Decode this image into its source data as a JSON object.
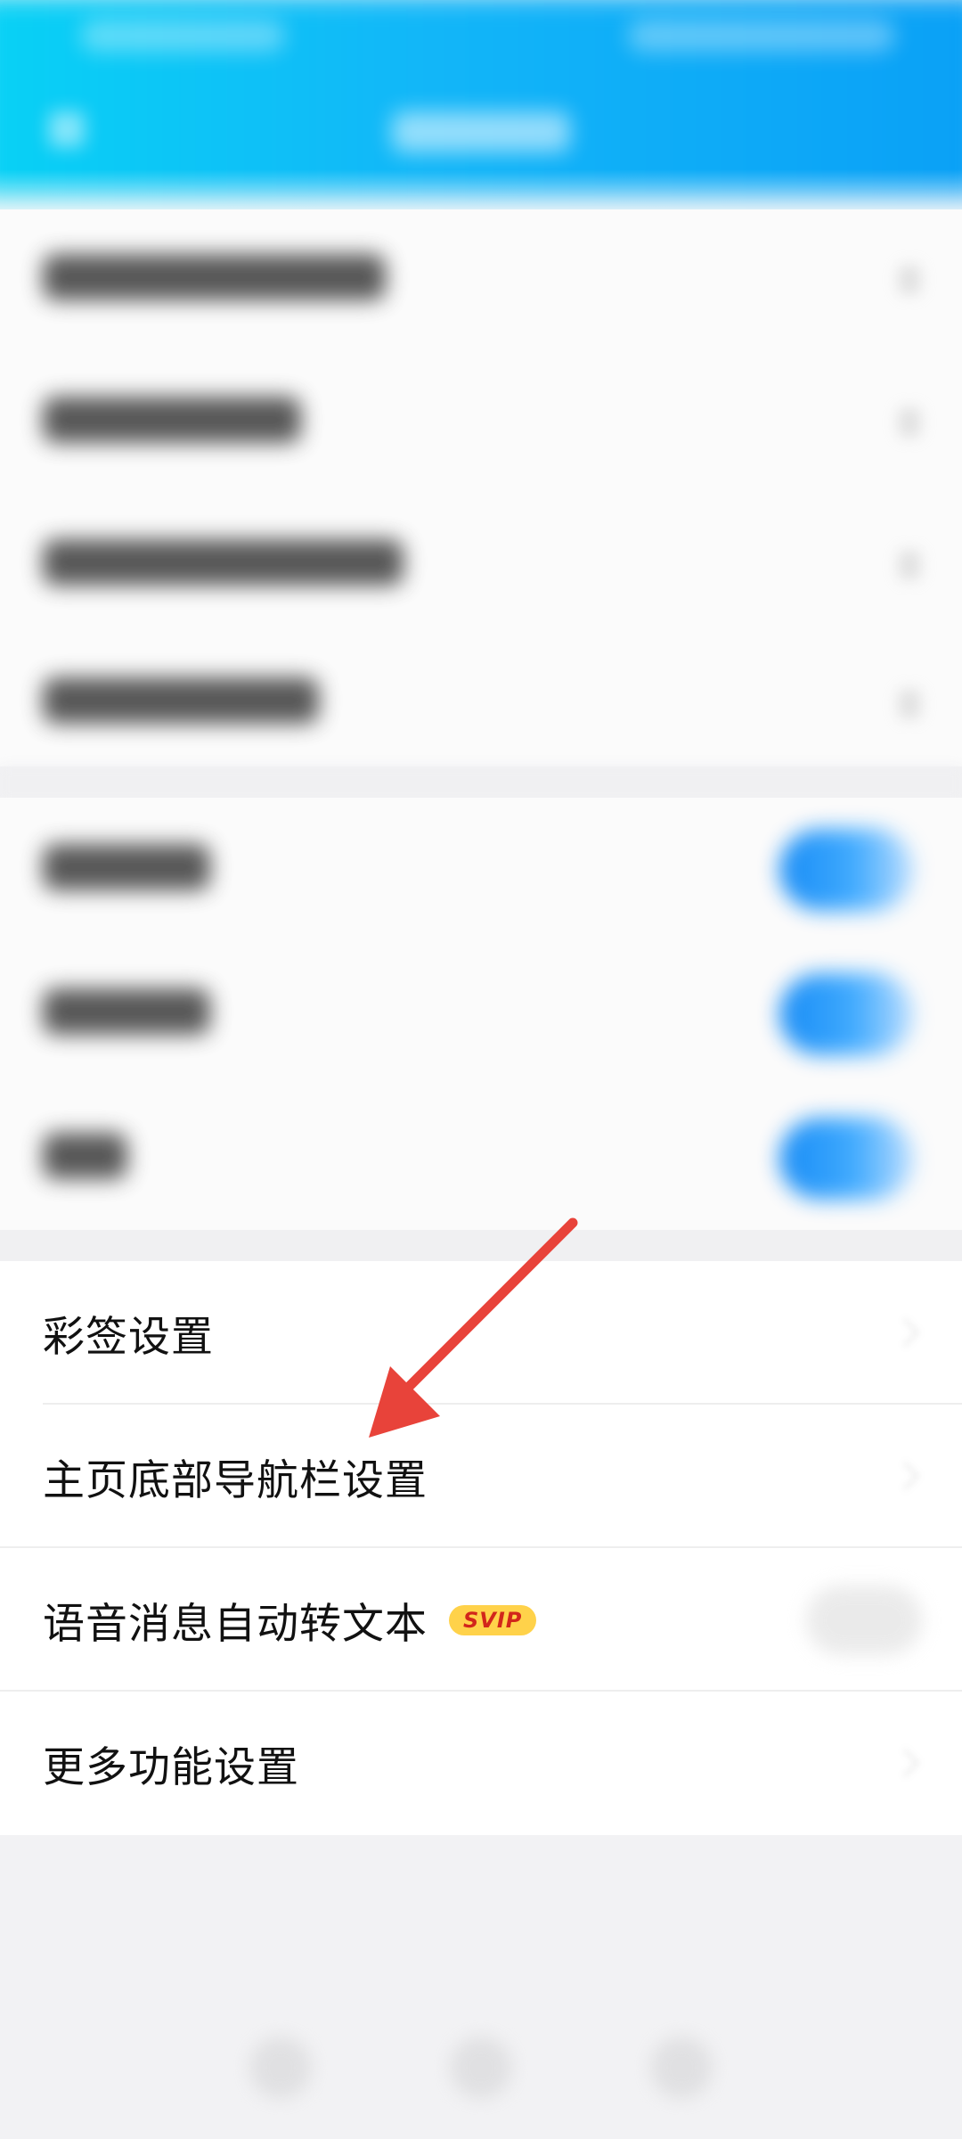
{
  "settings_list": {
    "items": [
      {
        "label": "彩签设置"
      },
      {
        "label": "主页底部导航栏设置"
      },
      {
        "label": "语音消息自动转文本",
        "badge": "SVIP"
      },
      {
        "label": "更多功能设置"
      }
    ]
  },
  "colors": {
    "header_gradient_start": "#08d2f5",
    "header_gradient_end": "#0aa0f6",
    "toggle_on": "#0b86f5",
    "arrow": "#e8433a",
    "badge_bg": "#ffd24a",
    "badge_text": "#d2261b"
  },
  "icons": {
    "annotation": "red-arrow-icon",
    "chevron": "chevron-right-icon"
  }
}
